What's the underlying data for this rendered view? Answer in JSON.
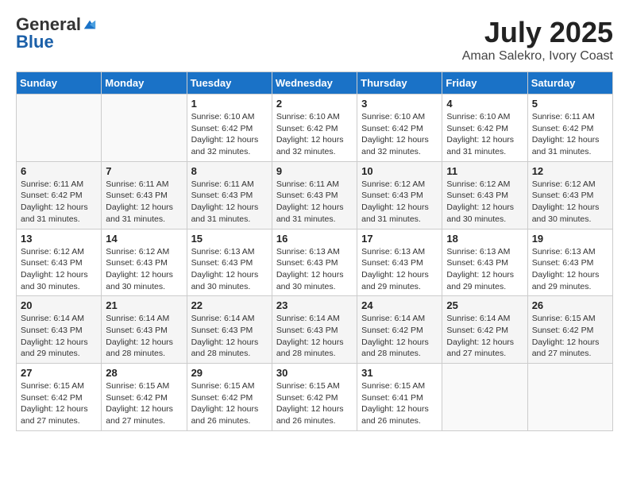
{
  "logo": {
    "general": "General",
    "blue": "Blue"
  },
  "title": "July 2025",
  "subtitle": "Aman Salekro, Ivory Coast",
  "days_of_week": [
    "Sunday",
    "Monday",
    "Tuesday",
    "Wednesday",
    "Thursday",
    "Friday",
    "Saturday"
  ],
  "weeks": [
    [
      {
        "day": "",
        "sunrise": "",
        "sunset": "",
        "daylight": ""
      },
      {
        "day": "",
        "sunrise": "",
        "sunset": "",
        "daylight": ""
      },
      {
        "day": "1",
        "sunrise": "Sunrise: 6:10 AM",
        "sunset": "Sunset: 6:42 PM",
        "daylight": "Daylight: 12 hours and 32 minutes."
      },
      {
        "day": "2",
        "sunrise": "Sunrise: 6:10 AM",
        "sunset": "Sunset: 6:42 PM",
        "daylight": "Daylight: 12 hours and 32 minutes."
      },
      {
        "day": "3",
        "sunrise": "Sunrise: 6:10 AM",
        "sunset": "Sunset: 6:42 PM",
        "daylight": "Daylight: 12 hours and 32 minutes."
      },
      {
        "day": "4",
        "sunrise": "Sunrise: 6:10 AM",
        "sunset": "Sunset: 6:42 PM",
        "daylight": "Daylight: 12 hours and 31 minutes."
      },
      {
        "day": "5",
        "sunrise": "Sunrise: 6:11 AM",
        "sunset": "Sunset: 6:42 PM",
        "daylight": "Daylight: 12 hours and 31 minutes."
      }
    ],
    [
      {
        "day": "6",
        "sunrise": "Sunrise: 6:11 AM",
        "sunset": "Sunset: 6:42 PM",
        "daylight": "Daylight: 12 hours and 31 minutes."
      },
      {
        "day": "7",
        "sunrise": "Sunrise: 6:11 AM",
        "sunset": "Sunset: 6:43 PM",
        "daylight": "Daylight: 12 hours and 31 minutes."
      },
      {
        "day": "8",
        "sunrise": "Sunrise: 6:11 AM",
        "sunset": "Sunset: 6:43 PM",
        "daylight": "Daylight: 12 hours and 31 minutes."
      },
      {
        "day": "9",
        "sunrise": "Sunrise: 6:11 AM",
        "sunset": "Sunset: 6:43 PM",
        "daylight": "Daylight: 12 hours and 31 minutes."
      },
      {
        "day": "10",
        "sunrise": "Sunrise: 6:12 AM",
        "sunset": "Sunset: 6:43 PM",
        "daylight": "Daylight: 12 hours and 31 minutes."
      },
      {
        "day": "11",
        "sunrise": "Sunrise: 6:12 AM",
        "sunset": "Sunset: 6:43 PM",
        "daylight": "Daylight: 12 hours and 30 minutes."
      },
      {
        "day": "12",
        "sunrise": "Sunrise: 6:12 AM",
        "sunset": "Sunset: 6:43 PM",
        "daylight": "Daylight: 12 hours and 30 minutes."
      }
    ],
    [
      {
        "day": "13",
        "sunrise": "Sunrise: 6:12 AM",
        "sunset": "Sunset: 6:43 PM",
        "daylight": "Daylight: 12 hours and 30 minutes."
      },
      {
        "day": "14",
        "sunrise": "Sunrise: 6:12 AM",
        "sunset": "Sunset: 6:43 PM",
        "daylight": "Daylight: 12 hours and 30 minutes."
      },
      {
        "day": "15",
        "sunrise": "Sunrise: 6:13 AM",
        "sunset": "Sunset: 6:43 PM",
        "daylight": "Daylight: 12 hours and 30 minutes."
      },
      {
        "day": "16",
        "sunrise": "Sunrise: 6:13 AM",
        "sunset": "Sunset: 6:43 PM",
        "daylight": "Daylight: 12 hours and 30 minutes."
      },
      {
        "day": "17",
        "sunrise": "Sunrise: 6:13 AM",
        "sunset": "Sunset: 6:43 PM",
        "daylight": "Daylight: 12 hours and 29 minutes."
      },
      {
        "day": "18",
        "sunrise": "Sunrise: 6:13 AM",
        "sunset": "Sunset: 6:43 PM",
        "daylight": "Daylight: 12 hours and 29 minutes."
      },
      {
        "day": "19",
        "sunrise": "Sunrise: 6:13 AM",
        "sunset": "Sunset: 6:43 PM",
        "daylight": "Daylight: 12 hours and 29 minutes."
      }
    ],
    [
      {
        "day": "20",
        "sunrise": "Sunrise: 6:14 AM",
        "sunset": "Sunset: 6:43 PM",
        "daylight": "Daylight: 12 hours and 29 minutes."
      },
      {
        "day": "21",
        "sunrise": "Sunrise: 6:14 AM",
        "sunset": "Sunset: 6:43 PM",
        "daylight": "Daylight: 12 hours and 28 minutes."
      },
      {
        "day": "22",
        "sunrise": "Sunrise: 6:14 AM",
        "sunset": "Sunset: 6:43 PM",
        "daylight": "Daylight: 12 hours and 28 minutes."
      },
      {
        "day": "23",
        "sunrise": "Sunrise: 6:14 AM",
        "sunset": "Sunset: 6:43 PM",
        "daylight": "Daylight: 12 hours and 28 minutes."
      },
      {
        "day": "24",
        "sunrise": "Sunrise: 6:14 AM",
        "sunset": "Sunset: 6:42 PM",
        "daylight": "Daylight: 12 hours and 28 minutes."
      },
      {
        "day": "25",
        "sunrise": "Sunrise: 6:14 AM",
        "sunset": "Sunset: 6:42 PM",
        "daylight": "Daylight: 12 hours and 27 minutes."
      },
      {
        "day": "26",
        "sunrise": "Sunrise: 6:15 AM",
        "sunset": "Sunset: 6:42 PM",
        "daylight": "Daylight: 12 hours and 27 minutes."
      }
    ],
    [
      {
        "day": "27",
        "sunrise": "Sunrise: 6:15 AM",
        "sunset": "Sunset: 6:42 PM",
        "daylight": "Daylight: 12 hours and 27 minutes."
      },
      {
        "day": "28",
        "sunrise": "Sunrise: 6:15 AM",
        "sunset": "Sunset: 6:42 PM",
        "daylight": "Daylight: 12 hours and 27 minutes."
      },
      {
        "day": "29",
        "sunrise": "Sunrise: 6:15 AM",
        "sunset": "Sunset: 6:42 PM",
        "daylight": "Daylight: 12 hours and 26 minutes."
      },
      {
        "day": "30",
        "sunrise": "Sunrise: 6:15 AM",
        "sunset": "Sunset: 6:42 PM",
        "daylight": "Daylight: 12 hours and 26 minutes."
      },
      {
        "day": "31",
        "sunrise": "Sunrise: 6:15 AM",
        "sunset": "Sunset: 6:41 PM",
        "daylight": "Daylight: 12 hours and 26 minutes."
      },
      {
        "day": "",
        "sunrise": "",
        "sunset": "",
        "daylight": ""
      },
      {
        "day": "",
        "sunrise": "",
        "sunset": "",
        "daylight": ""
      }
    ]
  ]
}
